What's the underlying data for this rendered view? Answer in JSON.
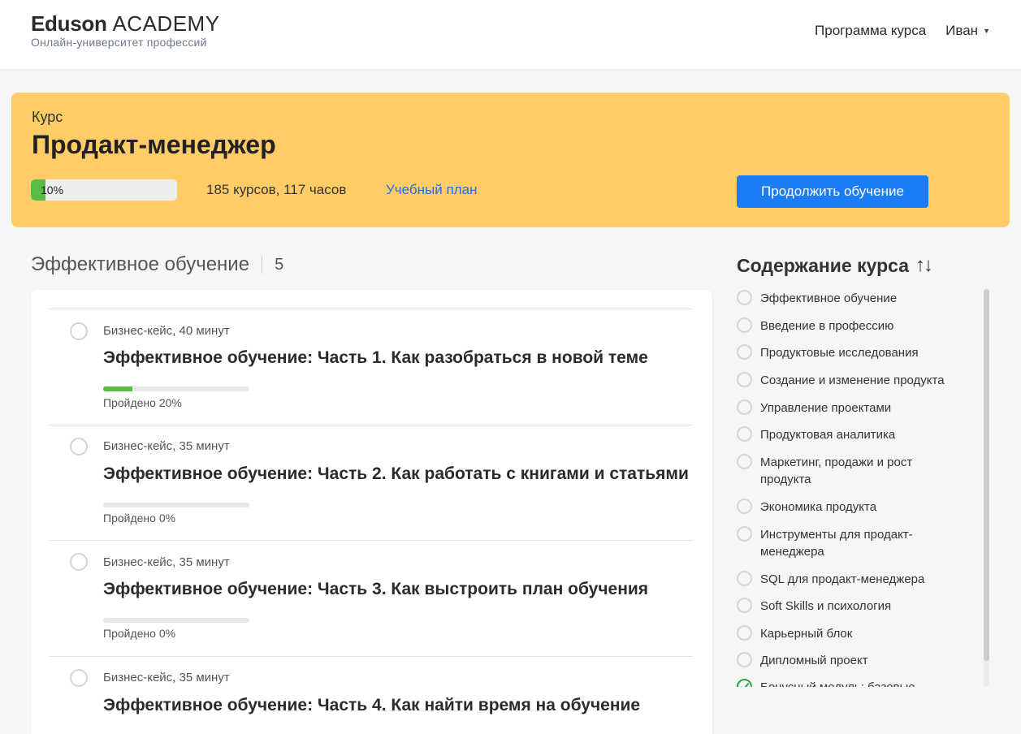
{
  "header": {
    "logo_bold": "Eduson",
    "logo_light": "ACADEMY",
    "logo_sub": "Онлайн-университет профессий",
    "nav_program": "Программа курса",
    "user_name": "Иван"
  },
  "banner": {
    "kicker": "Курс",
    "title": "Продакт-менеджер",
    "progress_value": 10,
    "progress_text": "10%",
    "stats": "185 курсов, 117 часов",
    "plan_link": "Учебный план",
    "cta": "Продолжить обучение",
    "bg_color": "#ffcc66",
    "accent_color": "#1a7df5",
    "progress_color": "#59bd45"
  },
  "section": {
    "title": "Эффективное обучение",
    "count": "5"
  },
  "lessons": [
    {
      "meta": "Бизнес-кейс, 40 минут",
      "title": "Эффективное обучение: Часть 1. Как разобраться в новой теме",
      "progress": 20,
      "done": "Пройдено 20%"
    },
    {
      "meta": "Бизнес-кейс, 35 минут",
      "title": "Эффективное обучение: Часть 2. Как работать с книгами и статьями",
      "progress": 0,
      "done": "Пройдено 0%"
    },
    {
      "meta": "Бизнес-кейс, 35 минут",
      "title": "Эффективное обучение: Часть 3. Как выстроить план обучения",
      "progress": 0,
      "done": "Пройдено 0%"
    },
    {
      "meta": "Бизнес-кейс, 35 минут",
      "title": "Эффективное обучение: Часть 4. Как найти время на обучение",
      "progress": null,
      "done": ""
    }
  ],
  "toc": {
    "title": "Содержание курса",
    "sort_icon": "↑↓",
    "items": [
      {
        "label": "Эффективное обучение",
        "checked": false
      },
      {
        "label": "Введение в профессию",
        "checked": false
      },
      {
        "label": "Продуктовые исследования",
        "checked": false
      },
      {
        "label": "Создание и изменение продукта",
        "checked": false
      },
      {
        "label": "Управление проектами",
        "checked": false
      },
      {
        "label": "Продуктовая аналитика",
        "checked": false
      },
      {
        "label": "Маркетинг, продажи и рост продукта",
        "checked": false
      },
      {
        "label": "Экономика продукта",
        "checked": false
      },
      {
        "label": "Инструменты для продакт-менеджера",
        "checked": false
      },
      {
        "label": "SQL для продакт-менеджера",
        "checked": false
      },
      {
        "label": "Soft Skills и психология",
        "checked": false
      },
      {
        "label": "Карьерный блок",
        "checked": false
      },
      {
        "label": "Дипломный проект",
        "checked": false
      },
      {
        "label": "Бонусный модуль: базовые",
        "checked": true
      }
    ]
  }
}
